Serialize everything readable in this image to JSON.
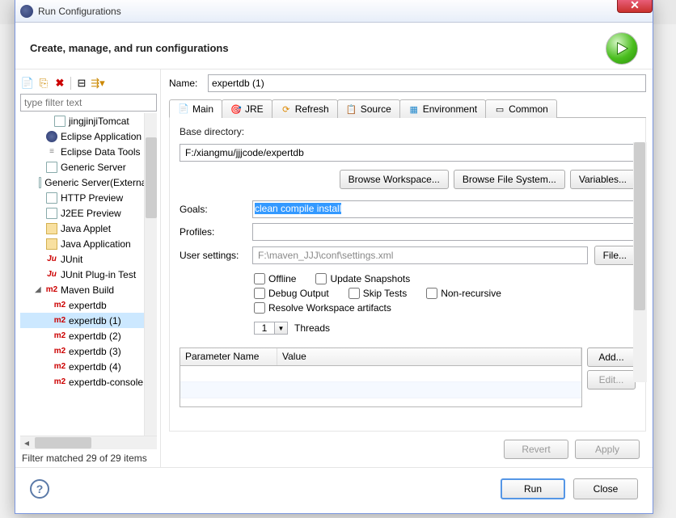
{
  "window": {
    "title": "Run Configurations"
  },
  "header": {
    "title": "Create, manage, and run configurations"
  },
  "sidebar": {
    "filter_placeholder": "type filter text",
    "items": [
      {
        "label": "jingjinjiTomcat",
        "icon": "doc",
        "indent": 2
      },
      {
        "label": "Eclipse Application",
        "icon": "ec",
        "indent": 1
      },
      {
        "label": "Eclipse Data Tools",
        "icon": "db",
        "indent": 1
      },
      {
        "label": "Generic Server",
        "icon": "doc",
        "indent": 1
      },
      {
        "label": "Generic Server(External...",
        "icon": "doc",
        "indent": 1
      },
      {
        "label": "HTTP Preview",
        "icon": "doc",
        "indent": 1
      },
      {
        "label": "J2EE Preview",
        "icon": "doc",
        "indent": 1
      },
      {
        "label": "Java Applet",
        "icon": "java",
        "indent": 1
      },
      {
        "label": "Java Application",
        "icon": "java",
        "indent": 1
      },
      {
        "label": "JUnit",
        "icon": "ju",
        "indent": 1
      },
      {
        "label": "JUnit Plug-in Test",
        "icon": "ju",
        "indent": 1
      },
      {
        "label": "Maven Build",
        "icon": "m2",
        "indent": 1,
        "expanded": true
      },
      {
        "label": "expertdb",
        "icon": "m2",
        "indent": 2
      },
      {
        "label": "expertdb (1)",
        "icon": "m2",
        "indent": 2,
        "selected": true
      },
      {
        "label": "expertdb (2)",
        "icon": "m2",
        "indent": 2
      },
      {
        "label": "expertdb (3)",
        "icon": "m2",
        "indent": 2
      },
      {
        "label": "expertdb (4)",
        "icon": "m2",
        "indent": 2
      },
      {
        "label": "expertdb-console",
        "icon": "m2",
        "indent": 2
      }
    ],
    "status": "Filter matched 29 of 29 items"
  },
  "main": {
    "name_label": "Name:",
    "name_value": "expertdb (1)",
    "tabs": [
      "Main",
      "JRE",
      "Refresh",
      "Source",
      "Environment",
      "Common"
    ],
    "base_dir_label": "Base directory:",
    "base_dir_value": "F:/xiangmu/jjjcode/expertdb",
    "browse_ws": "Browse Workspace...",
    "browse_fs": "Browse File System...",
    "variables": "Variables...",
    "goals_label": "Goals:",
    "goals_value": "clean compile install",
    "profiles_label": "Profiles:",
    "profiles_value": "",
    "usersettings_label": "User settings:",
    "usersettings_value": "F:\\maven_JJJ\\conf\\settings.xml",
    "file_btn": "File...",
    "checks": {
      "offline": "Offline",
      "update": "Update Snapshots",
      "debug": "Debug Output",
      "skip": "Skip Tests",
      "nonrec": "Non-recursive",
      "resolve": "Resolve Workspace artifacts"
    },
    "threads_value": "1",
    "threads_label": "Threads",
    "param_col1": "Parameter Name",
    "param_col2": "Value",
    "add_btn": "Add...",
    "edit_btn": "Edit...",
    "revert": "Revert",
    "apply": "Apply"
  },
  "footer": {
    "run": "Run",
    "close": "Close"
  }
}
